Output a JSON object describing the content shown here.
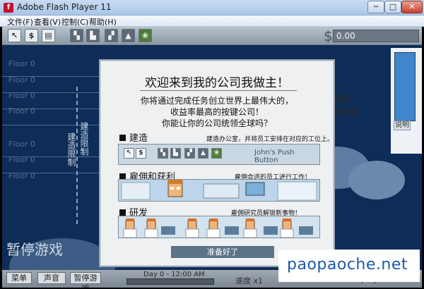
{
  "window": {
    "title": "Adobe Flash Player 11",
    "buttons": {
      "minimize": "─",
      "maximize": "□",
      "close": "✕"
    }
  },
  "menu": [
    "文件(F)",
    "查看(V)",
    "控制(C)",
    "帮助(H)"
  ],
  "toolbar": {
    "tools": [
      {
        "icon": "cursor-icon",
        "glyph": "↖"
      },
      {
        "icon": "dollar-icon",
        "glyph": "$"
      },
      {
        "icon": "document-icon",
        "glyph": "▤"
      },
      {
        "icon": "build-office-icon",
        "glyph": "▚"
      },
      {
        "icon": "workers-icon",
        "glyph": "▙"
      },
      {
        "icon": "staff-icon",
        "glyph": "▞"
      },
      {
        "icon": "research-icon",
        "glyph": "▲"
      },
      {
        "icon": "plant-icon",
        "glyph": "❀"
      }
    ],
    "currency_symbol": "$",
    "money": "0.00"
  },
  "floors": [
    "Floor 0",
    "Floor 0",
    "Floor 0",
    "Floor 0",
    "Floor 0",
    "Floor 0",
    "Floor 0"
  ],
  "overlays": {
    "vertical_left": "建造限制",
    "vertical_right": "建造限制",
    "paused": "暂停游戏",
    "side_text_1": "限制",
    "side_text_2": "由限制",
    "explain": "说明"
  },
  "modal": {
    "title": "欢迎来到我的公司我做主！",
    "intro_lines": [
      "你将通过完成任务创立世界上最伟大的，",
      "收益率最高的按键公司！",
      "你能让你的公司统领全球吗？"
    ],
    "sections": [
      {
        "heading": "建造",
        "description": "建造办公室，并将员工安排在对应的工位上。",
        "push_button_label": "John's Push Button"
      },
      {
        "heading": "雇佣和获利",
        "description": "雇佣合适的员工进行工作！"
      },
      {
        "heading": "研发",
        "description": "雇佣研究员解锁新事物！"
      }
    ],
    "ready_button": "准备好了"
  },
  "bottom": {
    "buttons": [
      "菜单",
      "声音",
      "暂停游戏"
    ],
    "day": "Day 0 - 12:00 AM",
    "speed": "速度 x1",
    "employees": "0 Employees"
  },
  "watermark": "paopaoche.net",
  "colors": {
    "sky": "#0d2c57",
    "panel": "#eef0f2",
    "accent": "#5d7387",
    "watermark": "#1f59a8"
  }
}
